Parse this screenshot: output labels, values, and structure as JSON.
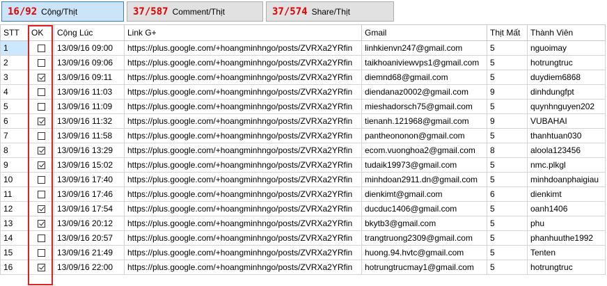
{
  "toolbar": {
    "stats": [
      {
        "value": "16/92",
        "label": "Cộng/Thịt"
      },
      {
        "value": "37/587",
        "label": "Comment/Thịt"
      },
      {
        "value": "37/574",
        "label": "Share/Thịt"
      }
    ]
  },
  "table": {
    "columns": [
      "STT",
      "OK",
      "Cộng Lúc",
      "Link G+",
      "Gmail",
      "Thịt Mất",
      "Thành Viên"
    ],
    "rows": [
      {
        "stt": "1",
        "ok": false,
        "time": "13/09/16 09:00",
        "link": "https://plus.google.com/+hoangminhngo/posts/ZVRXa2YRfin",
        "gmail": "linhkienvn247@gmail.com",
        "lost": "5",
        "member": "nguoimay"
      },
      {
        "stt": "2",
        "ok": false,
        "time": "13/09/16 09:06",
        "link": "https://plus.google.com/+hoangminhngo/posts/ZVRXa2YRfin",
        "gmail": "taikhoaniviewvps1@gmail.com",
        "lost": "5",
        "member": "hotrungtruc"
      },
      {
        "stt": "3",
        "ok": true,
        "time": "13/09/16 09:11",
        "link": "https://plus.google.com/+hoangminhngo/posts/ZVRXa2YRfin",
        "gmail": "diemnd68@gmail.com",
        "lost": "5",
        "member": "duydiem6868"
      },
      {
        "stt": "4",
        "ok": false,
        "time": "13/09/16 11:03",
        "link": "https://plus.google.com/+hoangminhngo/posts/ZVRXa2YRfin",
        "gmail": "diendanaz0002@gmail.com",
        "lost": "9",
        "member": "dinhdungfpt"
      },
      {
        "stt": "5",
        "ok": false,
        "time": "13/09/16 11:09",
        "link": "https://plus.google.com/+hoangminhngo/posts/ZVRXa2YRfin",
        "gmail": "mieshadorsch75@gmail.com",
        "lost": "5",
        "member": "quynhnguyen202"
      },
      {
        "stt": "6",
        "ok": true,
        "time": "13/09/16 11:32",
        "link": "https://plus.google.com/+hoangminhngo/posts/ZVRXa2YRfin",
        "gmail": "tienanh.121968@gmail.com",
        "lost": "9",
        "member": "VUBAHAI"
      },
      {
        "stt": "7",
        "ok": false,
        "time": "13/09/16 11:58",
        "link": "https://plus.google.com/+hoangminhngo/posts/ZVRXa2YRfin",
        "gmail": "pantheononon@gmail.com",
        "lost": "5",
        "member": "thanhtuan030"
      },
      {
        "stt": "8",
        "ok": true,
        "time": "13/09/16 13:29",
        "link": "https://plus.google.com/+hoangminhngo/posts/ZVRXa2YRfin",
        "gmail": "ecom.vuonghoa2@gmail.com",
        "lost": "8",
        "member": "aloola123456"
      },
      {
        "stt": "9",
        "ok": true,
        "time": "13/09/16 15:02",
        "link": "https://plus.google.com/+hoangminhngo/posts/ZVRXa2YRfin",
        "gmail": "tudaik19973@gmail.com",
        "lost": "5",
        "member": "nmc.plkgl"
      },
      {
        "stt": "10",
        "ok": false,
        "time": "13/09/16 17:40",
        "link": "https://plus.google.com/+hoangminhngo/posts/ZVRXa2YRfin",
        "gmail": "minhdoan2911.dn@gmail.com",
        "lost": "5",
        "member": "minhdoanphaigiau"
      },
      {
        "stt": "11",
        "ok": false,
        "time": "13/09/16 17:46",
        "link": "https://plus.google.com/+hoangminhngo/posts/ZVRXa2YRfin",
        "gmail": "dienkimt@gmail.com",
        "lost": "6",
        "member": "dienkimt"
      },
      {
        "stt": "12",
        "ok": true,
        "time": "13/09/16 17:54",
        "link": "https://plus.google.com/+hoangminhngo/posts/ZVRXa2YRfin",
        "gmail": "ducduc1406@gmail.com",
        "lost": "5",
        "member": "oanh1406"
      },
      {
        "stt": "13",
        "ok": true,
        "time": "13/09/16 20:12",
        "link": "https://plus.google.com/+hoangminhngo/posts/ZVRXa2YRfin",
        "gmail": "bkytb3@gmail.com",
        "lost": "5",
        "member": "phu"
      },
      {
        "stt": "14",
        "ok": false,
        "time": "13/09/16 20:57",
        "link": "https://plus.google.com/+hoangminhngo/posts/ZVRXa2YRfin",
        "gmail": "trangtruong2309@gmail.com",
        "lost": "5",
        "member": "phanhuuthe1992"
      },
      {
        "stt": "15",
        "ok": false,
        "time": "13/09/16 21:49",
        "link": "https://plus.google.com/+hoangminhngo/posts/ZVRXa2YRfin",
        "gmail": "huong.94.hvtc@gmail.com",
        "lost": "5",
        "member": "Tenten"
      },
      {
        "stt": "16",
        "ok": true,
        "time": "13/09/16 22:00",
        "link": "https://plus.google.com/+hoangminhngo/posts/ZVRXa2YRfin",
        "gmail": "hotrungtrucmay1@gmail.com",
        "lost": "5",
        "member": "hotrungtruc"
      }
    ]
  },
  "colors": {
    "accent_red": "#e00000",
    "selected_bg": "#cce4f7",
    "highlight": "#e02020"
  }
}
